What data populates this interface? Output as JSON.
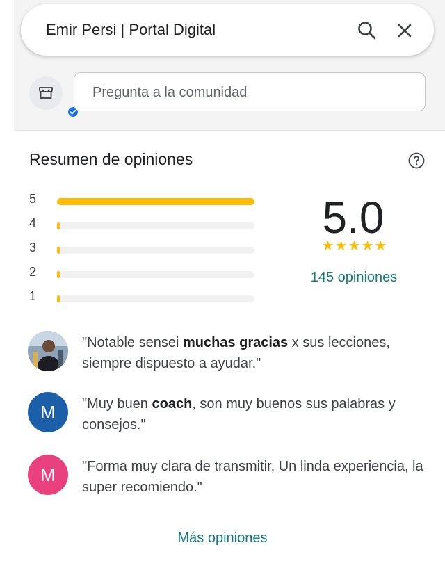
{
  "search": {
    "query": "Emir Persi | Portal Digital",
    "search_icon": "search-icon",
    "close_icon": "close-icon"
  },
  "ask": {
    "placeholder": "Pregunta a la comunidad",
    "avatar_icon": "storefront-icon",
    "badge_icon": "verified-check-icon"
  },
  "summary": {
    "title": "Resumen de opiniones",
    "help_icon": "help-circle-icon",
    "rating": "5.0",
    "stars": "★★★★★",
    "review_count": "145 opiniones",
    "distribution": [
      {
        "label": "5",
        "fraction": 1.0
      },
      {
        "label": "4",
        "fraction": 0.0
      },
      {
        "label": "3",
        "fraction": 0.0
      },
      {
        "label": "2",
        "fraction": 0.0
      },
      {
        "label": "1",
        "fraction": 0.0
      }
    ]
  },
  "reviews": [
    {
      "avatar": "photo",
      "before": "\"Notable sensei ",
      "bold": "muchas gracias",
      "after": " x sus lecciones, siempre dispuesto a ayudar.\""
    },
    {
      "avatar": "M",
      "avatar_color": "#1a5fa8",
      "before": "\"Muy buen ",
      "bold": "coach",
      "after": ", son muy buenos sus palabras y consejos.\""
    },
    {
      "avatar": "M",
      "avatar_color": "#e8417d",
      "before": "\"Forma muy clara de transmitir, Un linda experiencia, la super recomiendo.\"",
      "bold": "",
      "after": ""
    }
  ],
  "more_label": "Más opiniones",
  "colors": {
    "accent": "#137b7f",
    "star": "#fbbc04",
    "verified": "#1a73e8"
  }
}
